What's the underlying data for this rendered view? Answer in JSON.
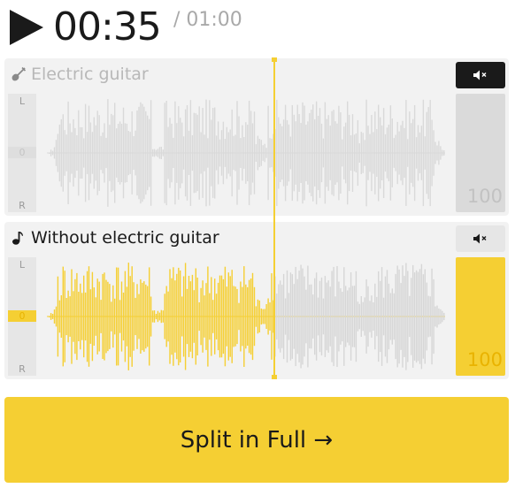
{
  "player": {
    "current_time": "00:35",
    "total_time": "/ 01:00",
    "progress": 0.58
  },
  "tracks": [
    {
      "title": "Electric guitar",
      "icon": "guitar-icon",
      "muted": true,
      "pan_labels": {
        "left": "L",
        "center": "0",
        "right": "R"
      },
      "volume": "100"
    },
    {
      "title": "Without electric guitar",
      "icon": "music-note-icon",
      "muted": false,
      "pan_labels": {
        "left": "L",
        "center": "0",
        "right": "R"
      },
      "volume": "100"
    }
  ],
  "split_button": {
    "label": "Split in Full →"
  },
  "colors": {
    "accent": "#f5cf33",
    "waveform_inactive": "#d6d6d6",
    "waveform_muted": "#d9d9d9",
    "text_dark": "#1a1a1a"
  }
}
